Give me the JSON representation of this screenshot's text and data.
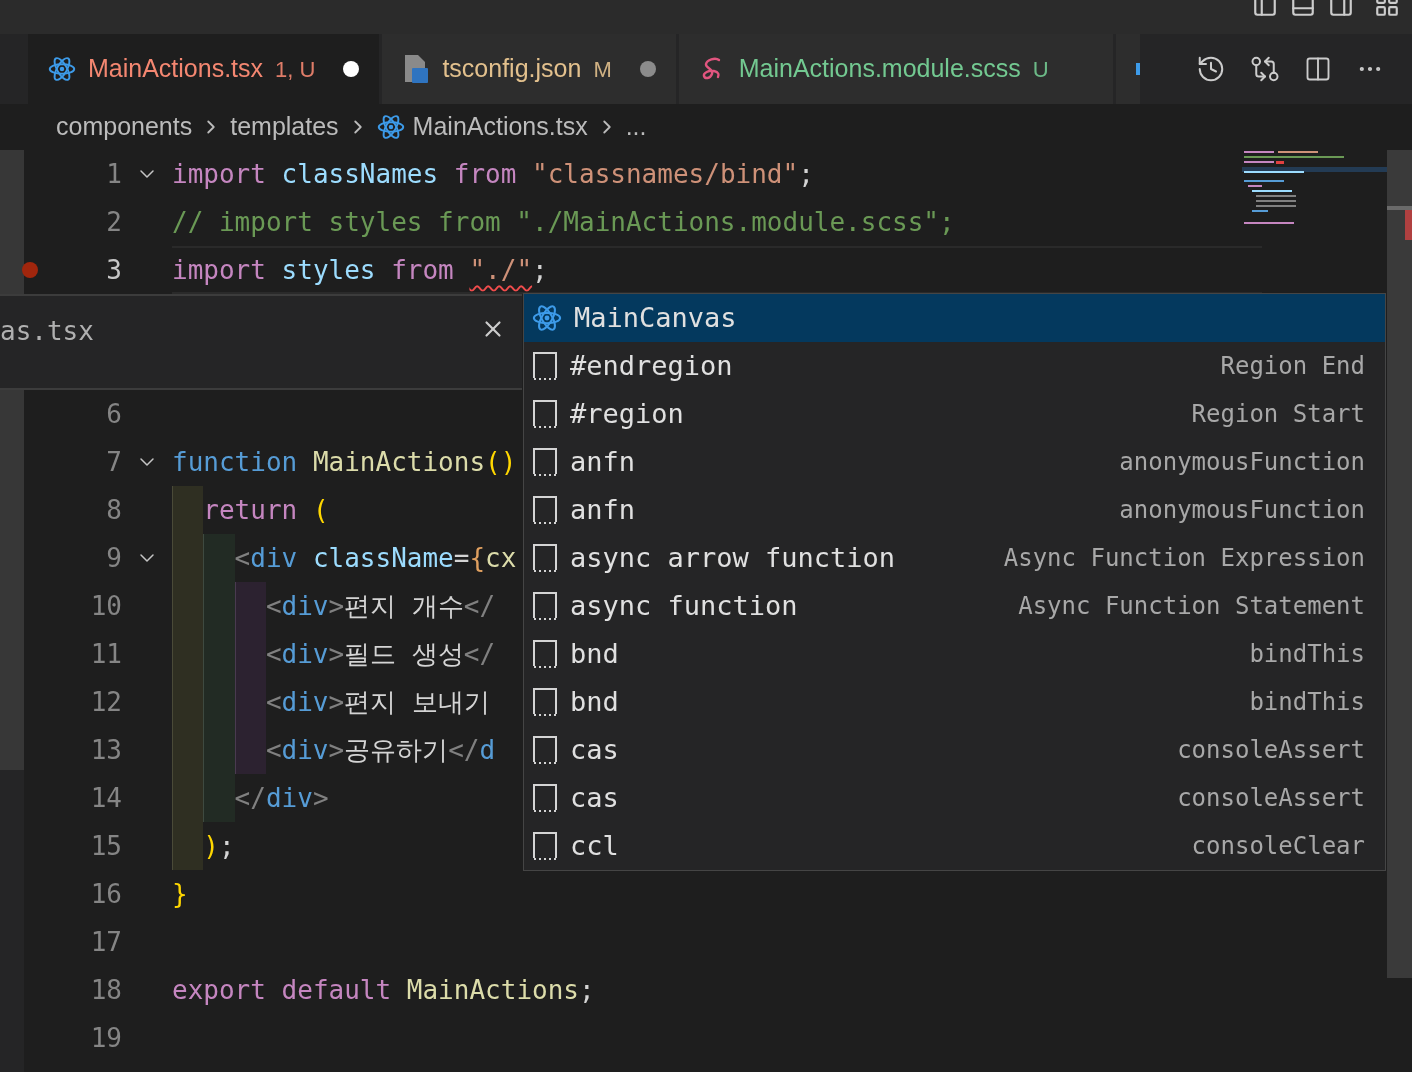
{
  "tabs": [
    {
      "label": "MainActions.tsx",
      "status": "1, U",
      "kind": "tsx",
      "color": "#f48771",
      "dirty": true,
      "selected": true
    },
    {
      "label": "tsconfig.json",
      "status": "M",
      "kind": "json",
      "color": "#e2c08d",
      "dirty": true,
      "selected": false
    },
    {
      "label": "MainActions.module.scss",
      "status": "U",
      "kind": "scss",
      "color": "#73c991",
      "dirty": false,
      "selected": false
    }
  ],
  "breadcrumb": [
    {
      "label": "components",
      "kind": "folder"
    },
    {
      "label": "templates",
      "kind": "folder"
    },
    {
      "label": "MainActions.tsx",
      "kind": "file"
    },
    {
      "label": "...",
      "kind": "symbol"
    }
  ],
  "editor": {
    "lines_top": [
      {
        "number": "1",
        "foldable": true,
        "breakpoint": false,
        "current": false,
        "tokens": [
          {
            "text": "import ",
            "kind": "keyword"
          },
          {
            "text": "classNames ",
            "kind": "variable"
          },
          {
            "text": "from ",
            "kind": "keyword"
          },
          {
            "text": "\"classnames/bind\"",
            "kind": "string"
          },
          {
            "text": ";",
            "kind": "punct"
          }
        ]
      },
      {
        "number": "2",
        "foldable": false,
        "breakpoint": false,
        "current": false,
        "tokens": [
          {
            "text": "// import styles from \"./MainActions.module.scss\";",
            "kind": "comment"
          }
        ]
      },
      {
        "number": "3",
        "foldable": false,
        "breakpoint": true,
        "current": true,
        "tokens": [
          {
            "text": "import ",
            "kind": "keyword"
          },
          {
            "text": "styles ",
            "kind": "variable"
          },
          {
            "text": "from ",
            "kind": "keyword"
          },
          {
            "text": "\"./\"",
            "kind": "string",
            "error": true
          },
          {
            "text": ";",
            "kind": "punct"
          }
        ]
      }
    ],
    "peek": {
      "title": "as.tsx"
    },
    "lines_bottom": [
      {
        "number": "6",
        "foldable": false,
        "breakpoint": false,
        "current": false
      },
      {
        "number": "7",
        "foldable": true,
        "breakpoint": false,
        "current": false,
        "tokens": [
          {
            "text": "function ",
            "kind": "storage"
          },
          {
            "text": "MainActions",
            "kind": "function"
          },
          {
            "text": "()",
            "kind": "bracket"
          }
        ]
      },
      {
        "number": "8",
        "foldable": false,
        "breakpoint": false,
        "current": false,
        "tokens": [
          {
            "text": "  return ",
            "kind": "keyword"
          },
          {
            "text": "(",
            "kind": "bracket"
          }
        ]
      },
      {
        "number": "9",
        "foldable": true,
        "breakpoint": false,
        "current": false,
        "tokens": [
          {
            "text": "    <",
            "kind": "tagpunct"
          },
          {
            "text": "div ",
            "kind": "storage"
          },
          {
            "text": "className",
            "kind": "variable"
          },
          {
            "text": "=",
            "kind": "punct"
          },
          {
            "text": "{",
            "kind": "brace"
          },
          {
            "text": "cx",
            "kind": "function"
          }
        ]
      },
      {
        "number": "10",
        "foldable": false,
        "breakpoint": false,
        "current": false,
        "tokens": [
          {
            "text": "      <",
            "kind": "tagpunct"
          },
          {
            "text": "div",
            "kind": "storage"
          },
          {
            "text": ">",
            "kind": "tagpunct"
          },
          {
            "text": "편지 개수",
            "kind": "text"
          },
          {
            "text": "</",
            "kind": "tagpunct"
          }
        ]
      },
      {
        "number": "11",
        "foldable": false,
        "breakpoint": false,
        "current": false,
        "tokens": [
          {
            "text": "      <",
            "kind": "tagpunct"
          },
          {
            "text": "div",
            "kind": "storage"
          },
          {
            "text": ">",
            "kind": "tagpunct"
          },
          {
            "text": "필드 생성",
            "kind": "text"
          },
          {
            "text": "</",
            "kind": "tagpunct"
          }
        ]
      },
      {
        "number": "12",
        "foldable": false,
        "breakpoint": false,
        "current": false,
        "tokens": [
          {
            "text": "      <",
            "kind": "tagpunct"
          },
          {
            "text": "div",
            "kind": "storage"
          },
          {
            "text": ">",
            "kind": "tagpunct"
          },
          {
            "text": "편지 보내기",
            "kind": "text"
          }
        ]
      },
      {
        "number": "13",
        "foldable": false,
        "breakpoint": false,
        "current": false,
        "tokens": [
          {
            "text": "      <",
            "kind": "tagpunct"
          },
          {
            "text": "div",
            "kind": "storage"
          },
          {
            "text": ">",
            "kind": "tagpunct"
          },
          {
            "text": "공유하기",
            "kind": "text"
          },
          {
            "text": "</",
            "kind": "tagpunct"
          },
          {
            "text": "d",
            "kind": "storage"
          }
        ]
      },
      {
        "number": "14",
        "foldable": false,
        "breakpoint": false,
        "current": false,
        "tokens": [
          {
            "text": "    </",
            "kind": "tagpunct"
          },
          {
            "text": "div",
            "kind": "storage"
          },
          {
            "text": ">",
            "kind": "tagpunct"
          }
        ]
      },
      {
        "number": "15",
        "foldable": false,
        "breakpoint": false,
        "current": false,
        "tokens": [
          {
            "text": "  )",
            "kind": "bracket"
          },
          {
            "text": ";",
            "kind": "punct"
          }
        ]
      },
      {
        "number": "16",
        "foldable": false,
        "breakpoint": false,
        "current": false,
        "tokens": [
          {
            "text": "}",
            "kind": "bracket"
          }
        ]
      },
      {
        "number": "17",
        "foldable": false,
        "breakpoint": false,
        "current": false
      },
      {
        "number": "18",
        "foldable": false,
        "breakpoint": false,
        "current": false,
        "tokens": [
          {
            "text": "export default ",
            "kind": "keyword"
          },
          {
            "text": "MainActions",
            "kind": "function"
          },
          {
            "text": ";",
            "kind": "punct"
          }
        ]
      },
      {
        "number": "19",
        "foldable": false,
        "breakpoint": false,
        "current": false
      }
    ]
  },
  "suggestions": [
    {
      "label": "MainCanvas",
      "kind": "react",
      "selected": true
    },
    {
      "label": "#endregion",
      "detail": "Region End",
      "kind": "snippet",
      "selected": false
    },
    {
      "label": "#region",
      "detail": "Region Start",
      "kind": "snippet",
      "selected": false
    },
    {
      "label": "anfn",
      "detail": "anonymousFunction",
      "kind": "snippet",
      "selected": false
    },
    {
      "label": "anfn",
      "detail": "anonymousFunction",
      "kind": "snippet",
      "selected": false
    },
    {
      "label": "async arrow function",
      "detail": "Async Function Expression",
      "kind": "snippet",
      "selected": false
    },
    {
      "label": "async function",
      "detail": "Async Function Statement",
      "kind": "snippet",
      "selected": false
    },
    {
      "label": "bnd",
      "detail": "bindThis",
      "kind": "snippet",
      "selected": false
    },
    {
      "label": "bnd",
      "detail": "bindThis",
      "kind": "snippet",
      "selected": false
    },
    {
      "label": "cas",
      "detail": "consoleAssert",
      "kind": "snippet",
      "selected": false
    },
    {
      "label": "cas",
      "detail": "consoleAssert",
      "kind": "snippet",
      "selected": false
    },
    {
      "label": "ccl",
      "detail": "consoleClear",
      "kind": "snippet",
      "selected": false
    }
  ]
}
